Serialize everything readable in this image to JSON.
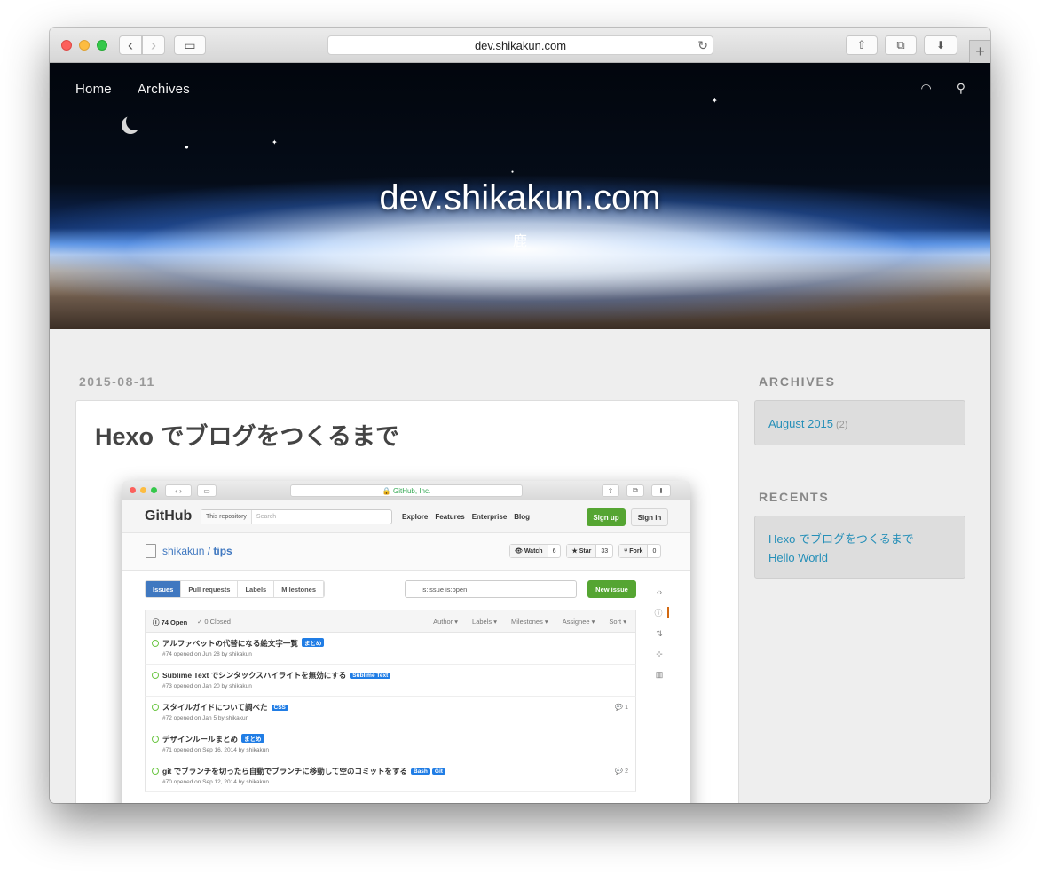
{
  "browser": {
    "url": "dev.shikakun.com",
    "back_icon": "‹",
    "forward_icon": "›",
    "sidebar_icon": "▭",
    "share_icon": "⇧",
    "tabs_icon": "⧉",
    "download_icon": "⬇",
    "reload_icon": "↻",
    "new_tab_icon": "+"
  },
  "hero": {
    "nav": [
      {
        "label": "Home"
      },
      {
        "label": "Archives"
      }
    ],
    "rss_icon": "◠",
    "search_icon": "⚲",
    "title": "dev.shikakun.com",
    "subtitle": "鹿"
  },
  "post": {
    "date": "2015-08-11",
    "title": "Hexo でブログをつくるまで"
  },
  "sidebar": {
    "archives_title": "ARCHIVES",
    "archives": [
      {
        "label": "August 2015",
        "count": "(2)"
      }
    ],
    "recents_title": "RECENTS",
    "recents": [
      {
        "label": "Hexo でブログをつくるまで"
      },
      {
        "label": "Hello World"
      }
    ]
  },
  "screenshot": {
    "url": "🔒 GitHub, Inc.",
    "logo": "GitHub",
    "search_scope": "This repository",
    "search_placeholder": "Search",
    "nav": [
      "Explore",
      "Features",
      "Enterprise",
      "Blog"
    ],
    "signup": "Sign up",
    "signin": "Sign in",
    "repo_owner": "shikakun",
    "repo_sep": " / ",
    "repo_name": "tips",
    "watch": {
      "label": "👁 Watch",
      "count": "6"
    },
    "star": {
      "label": "★ Star",
      "count": "33"
    },
    "fork": {
      "label": "⑂ Fork",
      "count": "0"
    },
    "subnav": [
      "Issues",
      "Pull requests",
      "Labels",
      "Milestones"
    ],
    "filter_value": "is:issue is:open",
    "new_issue": "New issue",
    "open_count": "ⓘ 74 Open",
    "closed_count": "✓ 0 Closed",
    "filters": [
      "Author ▾",
      "Labels ▾",
      "Milestones ▾",
      "Assignee ▾",
      "Sort ▾"
    ],
    "issues": [
      {
        "title": "アルファベットの代替になる絵文字一覧",
        "labels": [
          "まとめ"
        ],
        "meta": "#74 opened on Jun 28 by shikakun",
        "comments": ""
      },
      {
        "title": "Sublime Text でシンタックスハイライトを無効にする",
        "labels": [
          "Sublime Text"
        ],
        "meta": "#73 opened on Jan 20 by shikakun",
        "comments": ""
      },
      {
        "title": "スタイルガイドについて調べた",
        "labels": [
          "CSS"
        ],
        "meta": "#72 opened on Jan 5 by shikakun",
        "comments": "1"
      },
      {
        "title": "デザインルールまとめ",
        "labels": [
          "まとめ"
        ],
        "meta": "#71 opened on Sep 16, 2014 by shikakun",
        "comments": ""
      },
      {
        "title": "git でブランチを切ったら自動でブランチに移動して空のコミットをする",
        "labels": [
          "Bash",
          "Git"
        ],
        "meta": "#70 opened on Sep 12, 2014 by shikakun",
        "comments": "2"
      }
    ],
    "side_icons": [
      "‹›",
      "ⓘ",
      "⇅",
      "⊹",
      "▥"
    ]
  },
  "colors": {
    "link": "#258fb8",
    "github_green": "#55a532",
    "github_blue": "#4078c0",
    "label_blue": "#207de5"
  }
}
